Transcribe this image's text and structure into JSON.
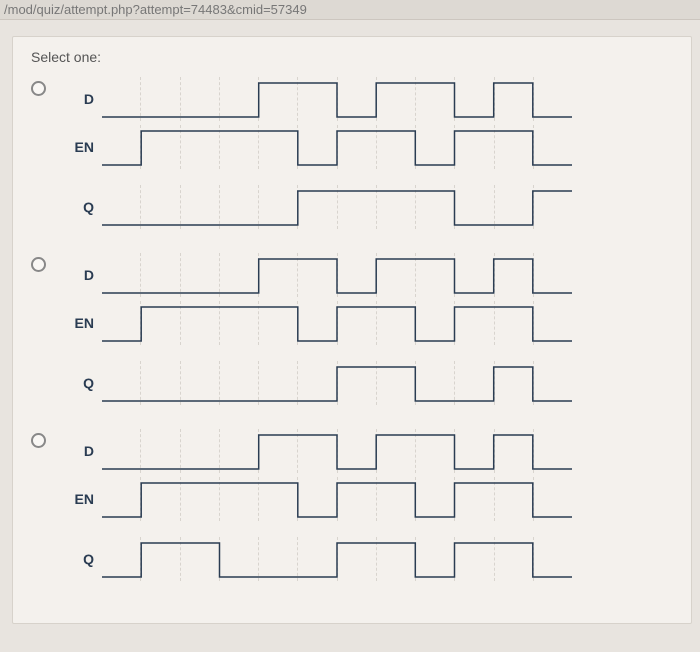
{
  "url_bar": "/mod/quiz/attempt.php?attempt=74483&cmid=57349",
  "prompt": "Select one:",
  "signal_labels": {
    "d": "D",
    "en": "EN",
    "q": "Q"
  },
  "chart_data": [
    {
      "type": "timing-diagram",
      "time_divisions": 12,
      "signals": {
        "D": [
          0,
          0,
          0,
          0,
          1,
          1,
          0,
          1,
          1,
          0,
          1,
          0
        ],
        "EN": [
          0,
          1,
          1,
          1,
          1,
          0,
          1,
          1,
          0,
          1,
          1,
          0
        ],
        "Q": [
          0,
          0,
          0,
          0,
          0,
          1,
          1,
          1,
          1,
          0,
          0,
          1
        ]
      }
    },
    {
      "type": "timing-diagram",
      "time_divisions": 12,
      "signals": {
        "D": [
          0,
          0,
          0,
          0,
          1,
          1,
          0,
          1,
          1,
          0,
          1,
          0
        ],
        "EN": [
          0,
          1,
          1,
          1,
          1,
          0,
          1,
          1,
          0,
          1,
          1,
          0
        ],
        "Q": [
          0,
          0,
          0,
          0,
          0,
          0,
          1,
          1,
          0,
          0,
          1,
          0
        ]
      }
    },
    {
      "type": "timing-diagram",
      "time_divisions": 12,
      "signals": {
        "D": [
          0,
          0,
          0,
          0,
          1,
          1,
          0,
          1,
          1,
          0,
          1,
          0
        ],
        "EN": [
          0,
          1,
          1,
          1,
          1,
          0,
          1,
          1,
          0,
          1,
          1,
          0
        ],
        "Q": [
          0,
          1,
          1,
          0,
          0,
          0,
          1,
          1,
          0,
          1,
          1,
          0
        ]
      }
    }
  ]
}
